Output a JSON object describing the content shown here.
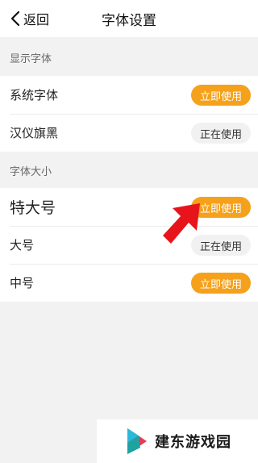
{
  "header": {
    "back_label": "返回",
    "title": "字体设置"
  },
  "display_font": {
    "section_label": "显示字体",
    "items": [
      {
        "label": "系统字体",
        "button": "立即使用",
        "state": "available"
      },
      {
        "label": "汉仪旗黑",
        "button": "正在使用",
        "state": "in-use"
      }
    ]
  },
  "font_size": {
    "section_label": "字体大小",
    "items": [
      {
        "label": "特大号",
        "button": "立即使用",
        "state": "available"
      },
      {
        "label": "大号",
        "button": "正在使用",
        "state": "in-use"
      },
      {
        "label": "中号",
        "button": "立即使用",
        "state": "available"
      }
    ]
  },
  "watermark": {
    "text": "建东游戏园"
  },
  "colors": {
    "accent": "#f5a11c",
    "in_use_bg": "#f1f1f1",
    "annotation_arrow": "#e8141b"
  },
  "icons": {
    "back": "chevron-left-icon",
    "annotation": "arrow-pointer-icon",
    "logo": "brand-logo-icon"
  }
}
